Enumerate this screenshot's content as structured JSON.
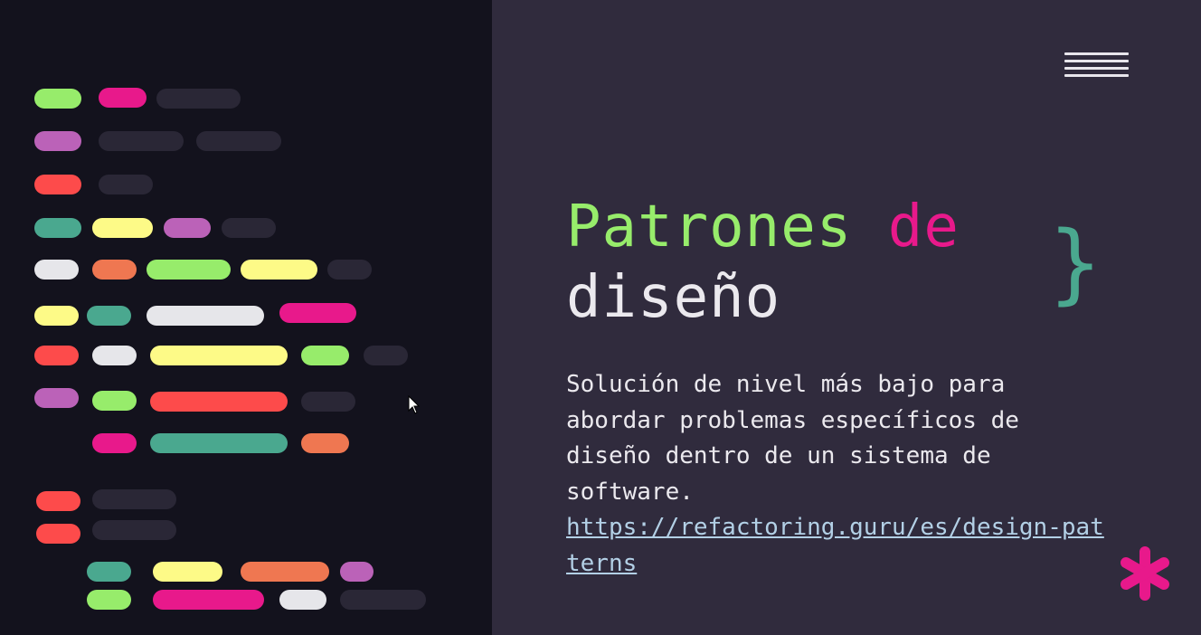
{
  "slide": {
    "title_part1": "Patrones",
    "title_part2": "de",
    "title_part3": "diseño",
    "description": "Solución de nivel más bajo para abordar problemas específicos de diseño dentro de un sistema de software.",
    "link_text": "https://refactoring.guru/es/design-patterns",
    "brace": "}"
  },
  "colors": {
    "accent_green": "#97ec6b",
    "accent_pink": "#e8198b",
    "accent_teal": "#4aa88f",
    "background_left": "#13121d",
    "background_right": "#302b3d"
  },
  "icons": {
    "menu": "hamburger-menu-icon",
    "asterisk": "asterisk-icon",
    "cursor": "mouse-cursor-icon"
  }
}
